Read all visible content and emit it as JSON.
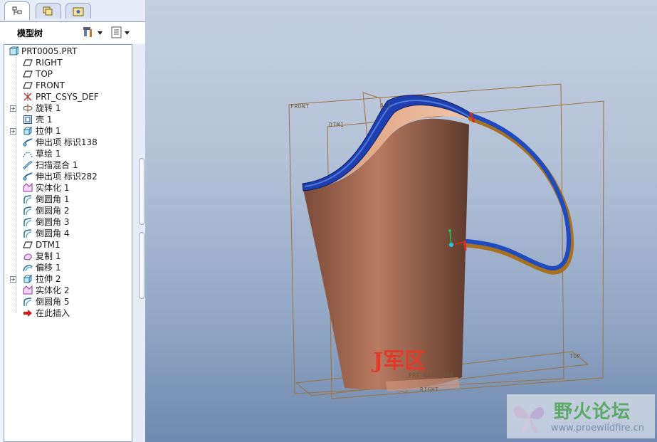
{
  "panel": {
    "tabs": [
      {
        "name": "model-tree-tab-icon"
      },
      {
        "name": "layers-tab-icon"
      },
      {
        "name": "folder-tab-icon"
      }
    ],
    "title": "模型树",
    "settings_icon": "tools-icon",
    "show_icon": "list-options-icon"
  },
  "tree": {
    "root": "PRT0005.PRT",
    "items": [
      {
        "label": "RIGHT",
        "icon": "datum-plane-icon"
      },
      {
        "label": "TOP",
        "icon": "datum-plane-icon"
      },
      {
        "label": "FRONT",
        "icon": "datum-plane-icon"
      },
      {
        "label": "PRT_CSYS_DEF",
        "icon": "csys-icon"
      },
      {
        "label": "旋转 1",
        "icon": "revolve-icon",
        "expandable": true
      },
      {
        "label": "壳 1",
        "icon": "shell-icon"
      },
      {
        "label": "拉伸 1",
        "icon": "extrude-icon",
        "expandable": true
      },
      {
        "label": "伸出项 标识138",
        "icon": "protrusion-icon"
      },
      {
        "label": "草绘 1",
        "icon": "sketch-icon"
      },
      {
        "label": "扫描混合 1",
        "icon": "swept-blend-icon"
      },
      {
        "label": "伸出项 标识282",
        "icon": "protrusion-icon"
      },
      {
        "label": "实体化 1",
        "icon": "solidify-icon"
      },
      {
        "label": "倒圆角 1",
        "icon": "round-icon"
      },
      {
        "label": "倒圆角 2",
        "icon": "round-icon"
      },
      {
        "label": "倒圆角 3",
        "icon": "round-icon"
      },
      {
        "label": "倒圆角 4",
        "icon": "round-icon"
      },
      {
        "label": "DTM1",
        "icon": "datum-plane-icon"
      },
      {
        "label": "复制 1",
        "icon": "copy-icon"
      },
      {
        "label": "偏移 1",
        "icon": "offset-icon"
      },
      {
        "label": "拉伸 2",
        "icon": "extrude-icon",
        "expandable": true
      },
      {
        "label": "实体化 2",
        "icon": "solidify-icon"
      },
      {
        "label": "倒圆角 5",
        "icon": "round-icon"
      },
      {
        "label": "在此插入",
        "icon": "insert-here-arrow-icon"
      }
    ]
  },
  "viewport": {
    "datum_labels": {
      "front": "FRONT",
      "dtm1": "DTM1",
      "top": "TOP",
      "right": "RIGHT",
      "csys": "PRT_CSYS_DEF",
      "axis": "A_1"
    },
    "overlay_text": "J军区",
    "watermark": {
      "title": "野火论坛",
      "url": "www.proewildfire.cn"
    }
  },
  "colors": {
    "cup_outer": "#a86a52",
    "cup_inner": "#e8b090",
    "rim": "#1f3fae",
    "handle": "#1f4bc0",
    "datum": "#a0713a",
    "background_top": "#c4cfe1",
    "background_bottom": "#6f89b0"
  }
}
